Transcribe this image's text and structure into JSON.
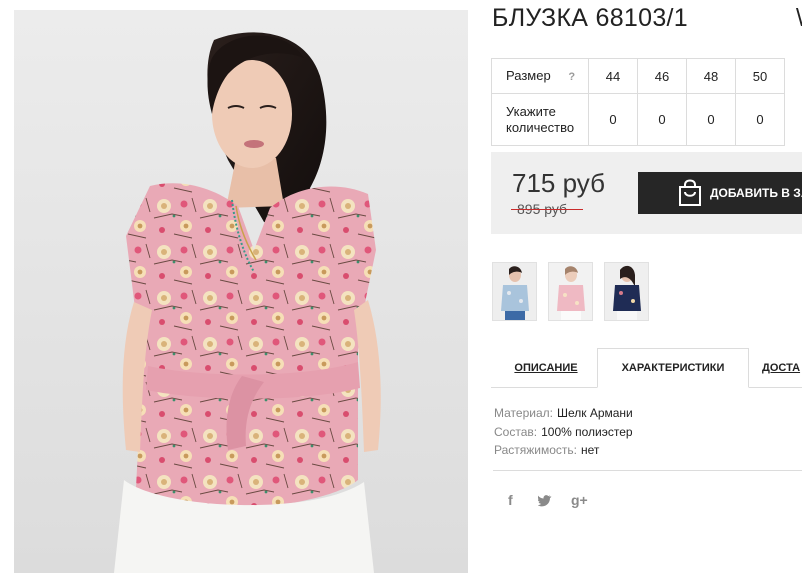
{
  "product": {
    "title": "БЛУЗКА 68103/1",
    "title_extra": "\\",
    "photo_icon": "product-photo"
  },
  "sizes": {
    "row_label": "Размер",
    "help": "?",
    "values": [
      "44",
      "46",
      "48",
      "50"
    ]
  },
  "quantity": {
    "row_label_1": "Укажите",
    "row_label_2": "количество",
    "values": [
      "0",
      "0",
      "0",
      "0"
    ]
  },
  "price": {
    "current": "715 руб",
    "old": "895 руб",
    "strike_color": "#c92b2b"
  },
  "cart_button": {
    "label": "ДОБАВИТЬ В ЗАК",
    "icon": "shopping-bag-icon"
  },
  "thumbnails": [
    {
      "icon": "thumb-light-blue-blouse"
    },
    {
      "icon": "thumb-pink-blouse"
    },
    {
      "icon": "thumb-navy-blouse"
    }
  ],
  "tabs": [
    {
      "label": "ОПИСАНИЕ"
    },
    {
      "label": "ХАРАКТЕРИСТИКИ"
    },
    {
      "label": "ДОСТА"
    }
  ],
  "specs": [
    {
      "key": "Материал:",
      "value": "Шелк Армани"
    },
    {
      "key": "Состав:",
      "value": "100% полиэстер"
    },
    {
      "key": "Растяжимость:",
      "value": "нет"
    }
  ],
  "social": [
    {
      "label": "f",
      "icon": "facebook-icon"
    },
    {
      "label": "✓",
      "icon": "twitter-icon"
    },
    {
      "label": "g+",
      "icon": "google-plus-icon"
    }
  ],
  "colors": {
    "accent_dark": "#262626",
    "price_panel": "#efefef",
    "blouse_pink": "#e8a5b4"
  }
}
